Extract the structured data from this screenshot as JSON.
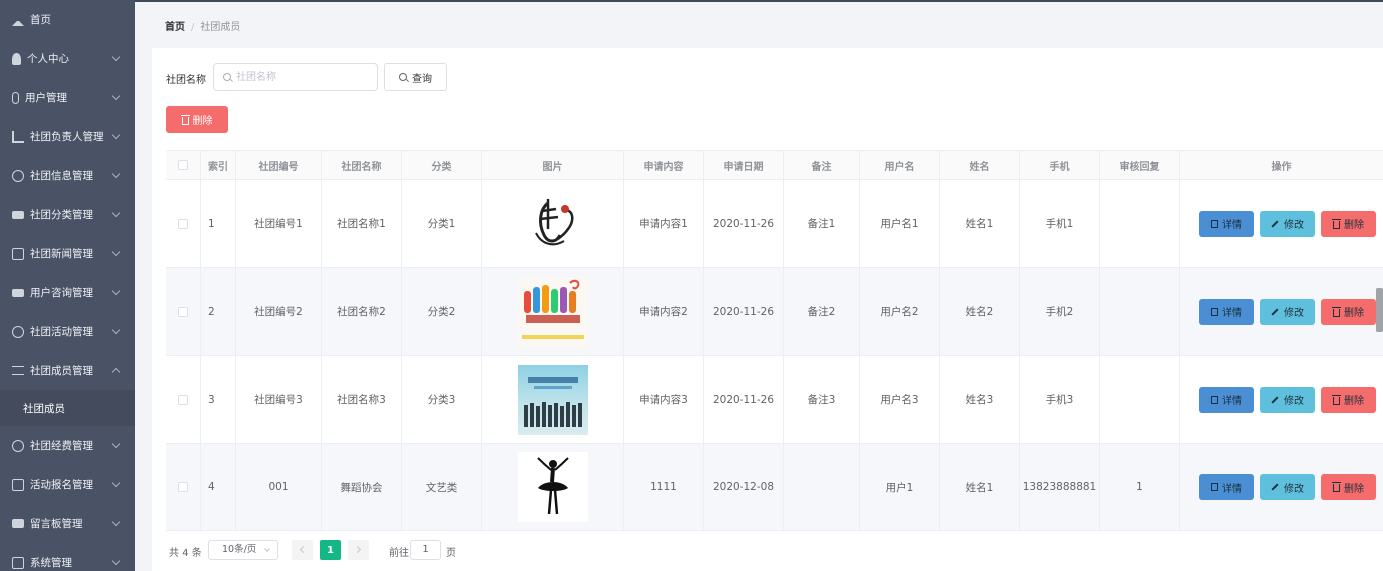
{
  "sidebar": {
    "items": [
      {
        "label": "首页",
        "icon": "home-icon"
      },
      {
        "label": "个人中心",
        "icon": "user-icon"
      },
      {
        "label": "用户管理",
        "icon": "microphone-icon"
      },
      {
        "label": "社团负责人管理",
        "icon": "bar-chart-icon"
      },
      {
        "label": "社团信息管理",
        "icon": "compass-icon"
      },
      {
        "label": "社团分类管理",
        "icon": "monitor-icon"
      },
      {
        "label": "社团新闻管理",
        "icon": "copy-icon"
      },
      {
        "label": "用户咨询管理",
        "icon": "chat-icon"
      },
      {
        "label": "社团活动管理",
        "icon": "clock-icon"
      },
      {
        "label": "社团成员管理",
        "icon": "list-icon"
      },
      {
        "label": "社团经费管理",
        "icon": "speedometer-icon"
      },
      {
        "label": "活动报名管理",
        "icon": "message-icon"
      },
      {
        "label": "留言板管理",
        "icon": "briefcase-icon"
      },
      {
        "label": "系统管理",
        "icon": "crop-icon"
      }
    ],
    "active_sub": "社团成员"
  },
  "breadcrumb": {
    "home": "首页",
    "sep": "/",
    "current": "社团成员"
  },
  "search": {
    "label": "社团名称",
    "placeholder": "社团名称",
    "value": "",
    "query_label": "查询"
  },
  "batch_delete_label": "删除",
  "table": {
    "headers": [
      "索引",
      "社团编号",
      "社团名称",
      "分类",
      "图片",
      "申请内容",
      "申请日期",
      "备注",
      "用户名",
      "姓名",
      "手机",
      "审核回复",
      "操作"
    ],
    "rows": [
      {
        "index": "1",
        "code": "社团编号1",
        "name": "社团名称1",
        "category": "分类1",
        "image": "calligraphy-logo",
        "content": "申请内容1",
        "date": "2020-11-26",
        "remark": "备注1",
        "username": "用户名1",
        "realname": "姓名1",
        "phone": "手机1",
        "reply": ""
      },
      {
        "index": "2",
        "code": "社团编号2",
        "name": "社团名称2",
        "category": "分类2",
        "image": "raised-hands-poster",
        "content": "申请内容2",
        "date": "2020-11-26",
        "remark": "备注2",
        "username": "用户名2",
        "realname": "姓名2",
        "phone": "手机2",
        "reply": ""
      },
      {
        "index": "3",
        "code": "社团编号3",
        "name": "社团名称3",
        "category": "分类3",
        "image": "group-photo-poster",
        "content": "申请内容3",
        "date": "2020-11-26",
        "remark": "备注3",
        "username": "用户名3",
        "realname": "姓名3",
        "phone": "手机3",
        "reply": ""
      },
      {
        "index": "4",
        "code": "001",
        "name": "舞蹈协会",
        "category": "文艺类",
        "image": "ballet-dancer-silhouette",
        "content": "1111",
        "date": "2020-12-08",
        "remark": "",
        "username": "用户1",
        "realname": "姓名1",
        "phone": "13823888881",
        "reply": "1"
      }
    ],
    "actions": {
      "detail": "详情",
      "edit": "修改",
      "delete": "删除"
    }
  },
  "pagination": {
    "total": "共 4 条",
    "page_size": "10条/页",
    "current_page": "1",
    "goto_label": "前往",
    "goto_value": "1",
    "unit": "页"
  },
  "colors": {
    "sidebar_bg": "#4a5366",
    "primary": "#4a8fd3",
    "info": "#5ec0dd",
    "danger": "#f56c6c",
    "page_active": "#13b884"
  }
}
